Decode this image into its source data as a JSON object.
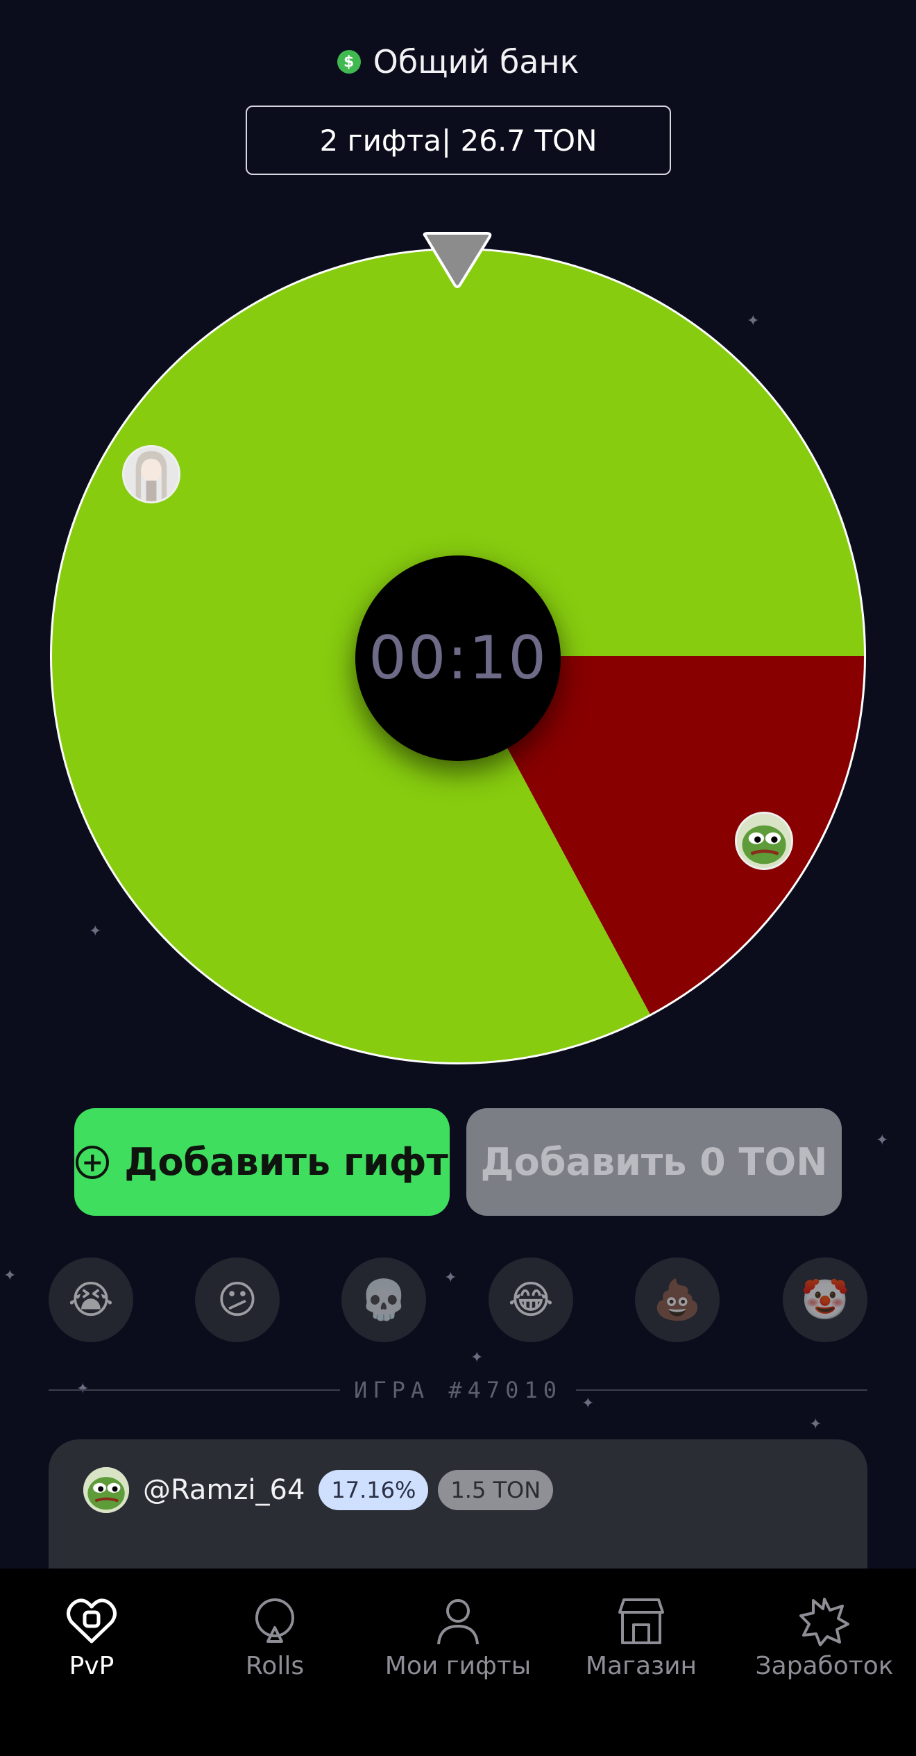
{
  "bank": {
    "icon": "dollar-icon",
    "title": "Общий банк",
    "summary": "2 гифта| 26.7 TON"
  },
  "wheel": {
    "timer": "00:10",
    "segments": [
      {
        "player": "girl-avatar",
        "color": "#87cc0f",
        "share": 0.8284
      },
      {
        "player": "@Ramzi_64",
        "color": "#880000",
        "share": 0.1716
      }
    ]
  },
  "actions": {
    "add_gift_label": "Добавить гифт",
    "add_ton_label": "Добавить 0 TON"
  },
  "reactions": [
    "😭",
    "😕",
    "💀",
    "😂",
    "💩",
    "🤡"
  ],
  "game": {
    "label": "ИГРА #47010"
  },
  "players": [
    {
      "name": "@Ramzi_64",
      "percent": "17.16%",
      "amount": "1.5 TON"
    }
  ],
  "nav": {
    "items": [
      {
        "label": "PvP",
        "icon": "heart-icon",
        "active": true
      },
      {
        "label": "Rolls",
        "icon": "roulette-icon",
        "active": false
      },
      {
        "label": "Мои гифты",
        "icon": "person-icon",
        "active": false
      },
      {
        "label": "Магазин",
        "icon": "shop-icon",
        "active": false
      },
      {
        "label": "Заработок",
        "icon": "star-badge-icon",
        "active": false
      }
    ]
  }
}
